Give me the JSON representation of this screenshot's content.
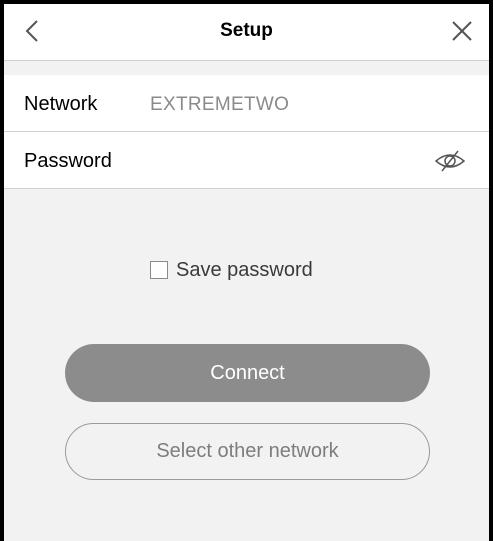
{
  "header": {
    "title": "Setup",
    "back_icon": "chevron-left-icon",
    "close_icon": "close-icon"
  },
  "form": {
    "network_label": "Network",
    "network_value": "EXTREMETWO",
    "password_label": "Password",
    "password_value": "",
    "password_toggle_icon": "eye-off-icon"
  },
  "options": {
    "save_password_label": "Save password",
    "save_password_checked": false
  },
  "actions": {
    "connect_label": "Connect",
    "select_other_label": "Select other network"
  },
  "colors": {
    "background": "#f2f2f2",
    "primary_button": "#8c8c8c",
    "secondary_text": "#7d7d7d"
  }
}
